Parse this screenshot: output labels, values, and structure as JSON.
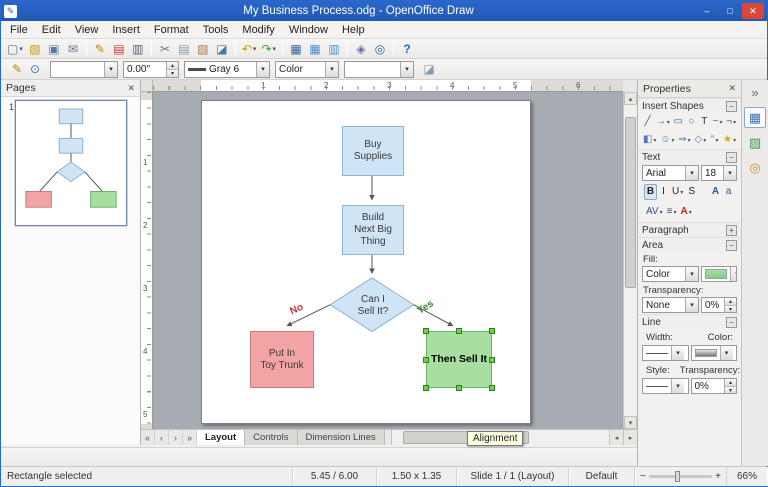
{
  "window": {
    "title": "My Business Process.odg - OpenOffice Draw",
    "accent": "#2b67ca",
    "controls": {
      "minimize": "–",
      "maximize": "□",
      "close": "✕"
    },
    "app_icon_glyph": "✎"
  },
  "ui": {
    "dd": "▾",
    "up": "▴",
    "down": "▾",
    "left": "◂",
    "right": "▸",
    "nav_first": "«",
    "nav_prev": "‹",
    "nav_next": "›",
    "nav_last": "»",
    "close": "✕",
    "zoom_out": "−",
    "zoom_in": "+"
  },
  "menu": [
    "File",
    "Edit",
    "View",
    "Insert",
    "Format",
    "Tools",
    "Modify",
    "Window",
    "Help"
  ],
  "toolbar_main": [
    {
      "name": "new-document-icon",
      "glyph": "▢",
      "color": "#667788",
      "dd": true
    },
    {
      "name": "open-icon",
      "glyph": "▨",
      "color": "#c9980f"
    },
    {
      "name": "save-icon",
      "glyph": "▣",
      "color": "#5577aa"
    },
    {
      "name": "email-icon",
      "glyph": "✉",
      "color": "#667788"
    },
    {
      "sep": true
    },
    {
      "name": "edit-file-icon",
      "glyph": "✎",
      "color": "#b8860b"
    },
    {
      "name": "export-pdf-icon",
      "glyph": "▤",
      "color": "#cc3333"
    },
    {
      "name": "print-icon",
      "glyph": "▥",
      "color": "#556677"
    },
    {
      "sep": true
    },
    {
      "name": "cut-icon",
      "glyph": "✂",
      "color": "#777777"
    },
    {
      "name": "copy-icon",
      "glyph": "▤",
      "color": "#8899aa"
    },
    {
      "name": "paste-icon",
      "glyph": "▧",
      "color": "#aa7744"
    },
    {
      "name": "format-paintbrush-icon",
      "glyph": "◪",
      "color": "#4477aa"
    },
    {
      "sep": true
    },
    {
      "name": "undo-icon",
      "glyph": "↶",
      "color": "#cc9900",
      "dd": true
    },
    {
      "name": "redo-icon",
      "glyph": "↷",
      "color": "#3a9a3a",
      "dd": true
    },
    {
      "sep": true
    },
    {
      "name": "chart-icon",
      "glyph": "▦",
      "color": "#336699"
    },
    {
      "name": "display-grid-icon",
      "glyph": "▦",
      "color": "#4a90d9"
    },
    {
      "name": "helplines-icon",
      "glyph": "▥",
      "color": "#4a90d9"
    },
    {
      "sep": true
    },
    {
      "name": "navigator-icon",
      "glyph": "◈",
      "color": "#7766aa"
    },
    {
      "name": "zoom-icon",
      "glyph": "◎",
      "color": "#336699"
    },
    {
      "sep": true
    },
    {
      "name": "help-icon",
      "glyph": "?",
      "color": "#2266cc",
      "bold": true
    }
  ],
  "toolbar_lf": {
    "icons_left": [
      {
        "name": "edit-points-icon",
        "glyph": "✎",
        "color": "#b8860b"
      },
      {
        "name": "glue-points-icon",
        "glyph": "⊙",
        "color": "#4477aa"
      }
    ],
    "width_value": "0.00\"",
    "line_color_value": "Gray 6",
    "fill_style_value": "Color",
    "icons_right": [
      {
        "name": "shadow-icon",
        "glyph": "◪",
        "color": "#8899aa"
      }
    ]
  },
  "pages_panel": {
    "title": "Pages",
    "page_number": "1"
  },
  "rulers": {
    "h": [
      "1",
      "2",
      "3",
      "4",
      "5",
      "6"
    ],
    "v": [
      "1",
      "2",
      "3",
      "4",
      "5"
    ]
  },
  "flowchart": {
    "buy": {
      "label": "Buy\nSupplies"
    },
    "build": {
      "label": "Build\nNext Big\nThing"
    },
    "decision": {
      "label": "Can I\nSell It?"
    },
    "trunk": {
      "label": "Put In\nToy Trunk"
    },
    "sell": {
      "label": "Then Sell It"
    },
    "no_label": "No",
    "yes_label": "Yes",
    "colors": {
      "process_fill": "#cfe4f5",
      "process_border": "#8db3d6",
      "reject_fill": "#f2a3a3",
      "reject_border": "#c97b7b",
      "accept_fill": "#a6dfa0",
      "accept_border": "#6fae68",
      "connector": "#555555",
      "no_color": "#c23b3b",
      "yes_color": "#2e8f2e"
    }
  },
  "tabs": [
    {
      "label": "Layout"
    },
    {
      "label": "Controls"
    },
    {
      "label": "Dimension Lines"
    }
  ],
  "tooltip": "Alignment",
  "properties": {
    "title": "Properties",
    "sections": [
      {
        "label": "Insert Shapes",
        "toggle": "−"
      },
      {
        "label": "Text",
        "toggle": "−"
      },
      {
        "label": "Paragraph",
        "toggle": "+"
      },
      {
        "label": "Area",
        "toggle": "−"
      },
      {
        "label": "Line",
        "toggle": "−"
      }
    ],
    "insert_shapes_row1": [
      {
        "name": "line-icon",
        "glyph": "╱",
        "color": "#336699"
      },
      {
        "name": "lines-arrows-icon",
        "glyph": "→",
        "color": "#336699",
        "dd": true
      },
      {
        "name": "rectangle-icon",
        "glyph": "▭",
        "color": "#336699"
      },
      {
        "name": "ellipse-icon",
        "glyph": "○",
        "color": "#336699"
      },
      {
        "name": "text-icon",
        "glyph": "T",
        "color": "#333333"
      },
      {
        "name": "curve-icon",
        "glyph": "~",
        "color": "#336699",
        "dd": true
      },
      {
        "name": "connector-icon",
        "glyph": "¬",
        "color": "#336699",
        "dd": true
      }
    ],
    "insert_shapes_row2": [
      {
        "name": "basic-shapes-icon",
        "glyph": "◧",
        "color": "#4a7ebb",
        "dd": true
      },
      {
        "name": "symbol-shapes-icon",
        "glyph": "☺",
        "color": "#4a7ebb",
        "dd": true
      },
      {
        "name": "block-arrows-icon",
        "glyph": "⇒",
        "color": "#4a7ebb",
        "dd": true
      },
      {
        "name": "flowchart-icon",
        "glyph": "◇",
        "color": "#4a7ebb",
        "dd": true
      },
      {
        "name": "callouts-icon",
        "glyph": "“",
        "color": "#4a7ebb",
        "dd": true
      },
      {
        "name": "stars-icon",
        "glyph": "★",
        "color": "#ccaa22",
        "dd": true
      }
    ],
    "text": {
      "font_name": "Arial",
      "font_size": "18",
      "format_icons": [
        {
          "name": "bold-button",
          "glyph": "B",
          "color": "#222222",
          "bold": true,
          "active": true
        },
        {
          "name": "italic-button",
          "glyph": "I",
          "color": "#222222"
        },
        {
          "name": "underline-button",
          "glyph": "U",
          "color": "#222222",
          "dd": true
        },
        {
          "name": "strikethrough-button",
          "glyph": "S",
          "color": "#222222"
        }
      ],
      "size_icons": [
        {
          "name": "increase-font-icon",
          "glyph": "A",
          "color": "#335588",
          "bold": true
        },
        {
          "name": "decrease-font-icon",
          "glyph": "a",
          "color": "#335588"
        }
      ],
      "spacing_icons": [
        {
          "name": "character-spacing-icon",
          "glyph": "AV",
          "color": "#335588",
          "dd": true
        },
        {
          "name": "line-spacing-icon",
          "glyph": "≡",
          "color": "#335588",
          "dd": true
        },
        {
          "name": "font-color-icon",
          "glyph": "A",
          "color": "#cc2222",
          "bold": true,
          "dd": true
        }
      ]
    },
    "area": {
      "fill_label": "Fill:",
      "fill_type": "Color",
      "fill_color": "#a6dfa0",
      "transparency_label": "Transparency:",
      "transparency_type": "None",
      "transparency_value": "0%"
    },
    "line": {
      "width_label": "Width:",
      "color_label": "Color:",
      "style_label": "Style:",
      "transparency_label": "Transparency:",
      "transparency_value": "0%"
    }
  },
  "sidebar_tabs": [
    {
      "name": "sidebar-collapse-icon",
      "glyph": "»",
      "color": "#556677"
    },
    {
      "name": "properties-tab-icon",
      "glyph": "▦",
      "color": "#3a6fc4",
      "active": true
    },
    {
      "name": "gallery-tab-icon",
      "glyph": "▨",
      "color": "#3f9e4d"
    },
    {
      "name": "navigator-tab-icon",
      "glyph": "◎",
      "color": "#d08a2a"
    }
  ],
  "statusbar": {
    "selection": "Rectangle selected",
    "position": "5.45 / 6.00",
    "size": "1.50 x 1.35",
    "slide": "Slide 1 / 1 (Layout)",
    "style": "Default",
    "zoom": "66%"
  }
}
